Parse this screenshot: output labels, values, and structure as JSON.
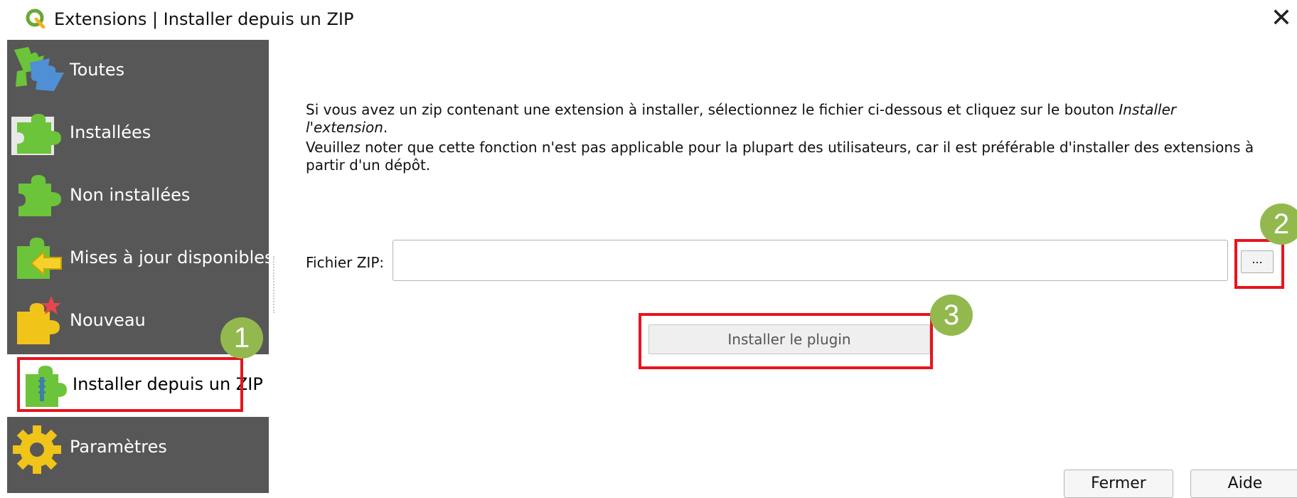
{
  "window": {
    "title": "Extensions | Installer depuis un ZIP",
    "app_icon": "qgis-logo-icon",
    "close_glyph": "✕"
  },
  "sidebar": {
    "items": [
      {
        "label": "Toutes",
        "icon": "puzzle-all-icon"
      },
      {
        "label": "Installées",
        "icon": "puzzle-installed-icon"
      },
      {
        "label": "Non installées",
        "icon": "puzzle-not-installed-icon"
      },
      {
        "label": "Mises à jour disponibles",
        "icon": "puzzle-upgradeable-icon"
      },
      {
        "label": "Nouveau",
        "icon": "puzzle-new-icon"
      },
      {
        "label": "Installer depuis un ZIP",
        "icon": "puzzle-zip-icon",
        "selected": true
      },
      {
        "label": "Paramètres",
        "icon": "gear-icon"
      }
    ]
  },
  "main": {
    "paragraph1_text": "Si vous avez un zip contenant une extension à installer, sélectionnez le fichier ci-dessous et cliquez sur le bouton ",
    "paragraph1_emph": "Installer l'extension",
    "paragraph1_end": ".",
    "paragraph2": "Veuillez noter que cette fonction n'est pas applicable pour la plupart des utilisateurs, car il est préférable d'installer des extensions à partir d'un dépôt.",
    "zip_label": "Fichier ZIP:",
    "zip_value": "",
    "browse_label": "...",
    "install_label": "Installer le plugin"
  },
  "annotations": {
    "badge1": "1",
    "badge2": "2",
    "badge3": "3",
    "highlight_color": "#e8141c",
    "badge_color": "#93b94e"
  },
  "footer": {
    "close_label": "Fermer",
    "help_label": "Aide"
  }
}
